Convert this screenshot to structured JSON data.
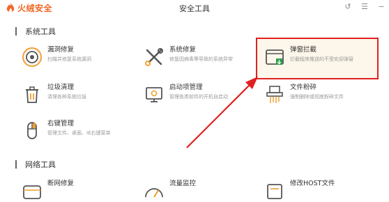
{
  "app": {
    "name": "火绒安全",
    "window_title": "安全工具"
  },
  "controls": {
    "back": "↺",
    "menu": "☰",
    "minimize": "−"
  },
  "sections": {
    "system": "系统工具",
    "network": "网络工具"
  },
  "items": {
    "vuln": {
      "title": "漏洞修复",
      "desc": "扫描并修复系统漏洞"
    },
    "sysrepair": {
      "title": "系统修复",
      "desc": "修复因病毒等导致的系统异常"
    },
    "popup": {
      "title": "弹窗拦截",
      "desc": "拦截程序推送的不受欢迎弹窗"
    },
    "junk": {
      "title": "垃圾清理",
      "desc": "清理各种系统垃圾"
    },
    "startup": {
      "title": "启动项管理",
      "desc": "管理各类软件的开机自启动"
    },
    "shred": {
      "title": "文件粉碎",
      "desc": "强制删除或彻底粉碎文件"
    },
    "rightclick": {
      "title": "右键管理",
      "desc": "管理文件、桌面、IE右键菜单"
    },
    "netrepair": {
      "title": "断网修复"
    },
    "traffic": {
      "title": "流量监控"
    },
    "host": {
      "title": "修改HOST文件"
    }
  },
  "colors": {
    "accent": "#f26522",
    "highlight_border": "#e02020",
    "icon_dark": "#555555",
    "icon_orange": "#f0a030"
  }
}
